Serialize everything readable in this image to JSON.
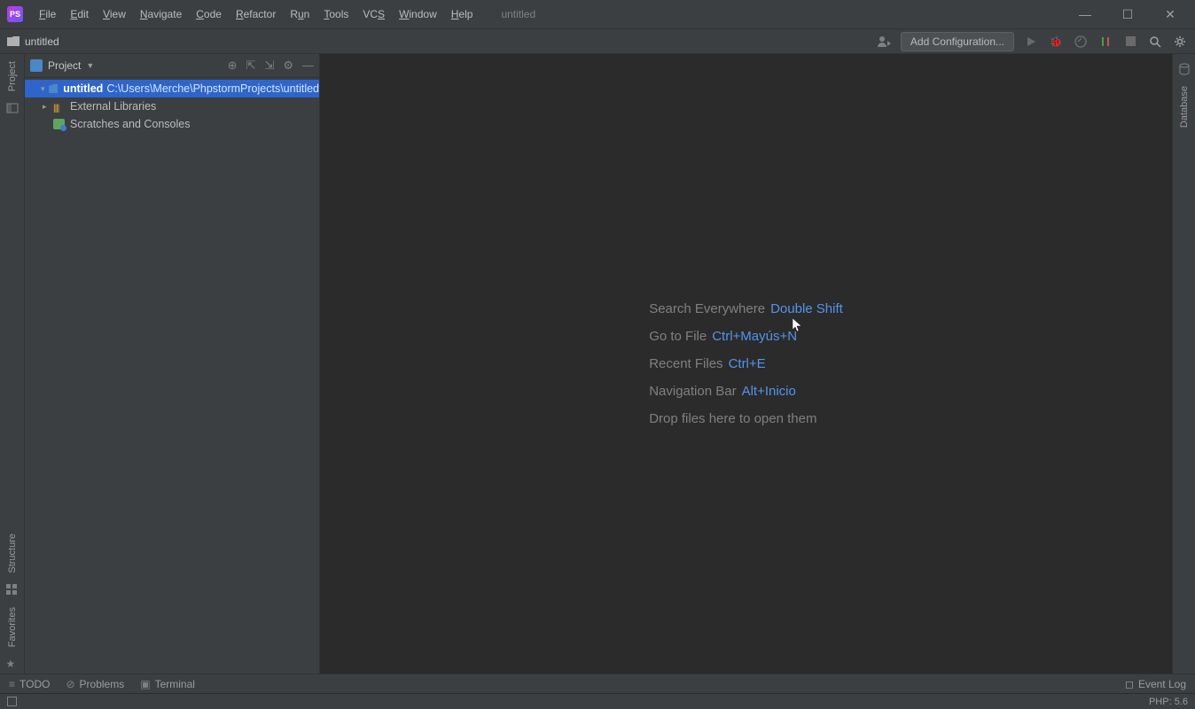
{
  "menu": {
    "items": [
      "File",
      "Edit",
      "View",
      "Navigate",
      "Code",
      "Refactor",
      "Run",
      "Tools",
      "VCS",
      "Window",
      "Help"
    ],
    "window_title": "untitled"
  },
  "breadcrumb": {
    "project": "untitled"
  },
  "toolbar": {
    "add_config": "Add Configuration..."
  },
  "project_panel": {
    "title": "Project",
    "tree": {
      "root": {
        "name": "untitled",
        "path": "C:\\Users\\Merche\\PhpstormProjects\\untitled"
      },
      "libraries": "External Libraries",
      "scratches": "Scratches and Consoles"
    }
  },
  "left_tabs": {
    "project": "Project",
    "structure": "Structure",
    "favorites": "Favorites"
  },
  "right_tabs": {
    "database": "Database"
  },
  "editor_hints": {
    "search_label": "Search Everywhere",
    "search_key": "Double Shift",
    "goto_label": "Go to File",
    "goto_key": "Ctrl+Mayús+N",
    "recent_label": "Recent Files",
    "recent_key": "Ctrl+E",
    "nav_label": "Navigation Bar",
    "nav_key": "Alt+Inicio",
    "drop": "Drop files here to open them"
  },
  "bottom": {
    "todo": "TODO",
    "problems": "Problems",
    "terminal": "Terminal",
    "event_log": "Event Log"
  },
  "status": {
    "php": "PHP: 5.6"
  }
}
